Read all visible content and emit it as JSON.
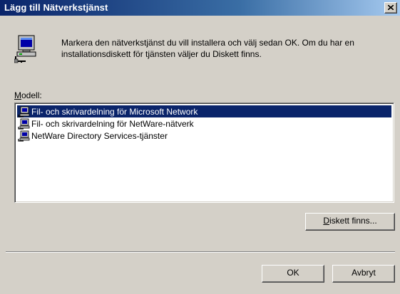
{
  "window": {
    "title": "Lägg till Nätverkstjänst",
    "close_label": "×"
  },
  "header": {
    "icon": "network-computer-icon",
    "description": "Markera den nätverkstjänst du vill installera och välj sedan OK. Om du har en installationsdiskett för tjänsten väljer du Diskett finns."
  },
  "model": {
    "label_prefix": "M",
    "label_rest": "odell:",
    "items": [
      {
        "label": "Fil- och skrivardelning för Microsoft Network",
        "selected": true,
        "icon": "network-service-icon"
      },
      {
        "label": "Fil- och skrivardelning för NetWare-nätverk",
        "selected": false,
        "icon": "network-service-icon"
      },
      {
        "label": "NetWare Directory Services-tjänster",
        "selected": false,
        "icon": "network-service-icon"
      }
    ]
  },
  "buttons": {
    "diskett_prefix": "D",
    "diskett_rest": "iskett finns...",
    "ok": "OK",
    "cancel": "Avbryt"
  },
  "colors": {
    "titlebar_start": "#0a246a",
    "titlebar_end": "#a6caf0",
    "selection": "#0a246a",
    "face": "#d4d0c8"
  }
}
